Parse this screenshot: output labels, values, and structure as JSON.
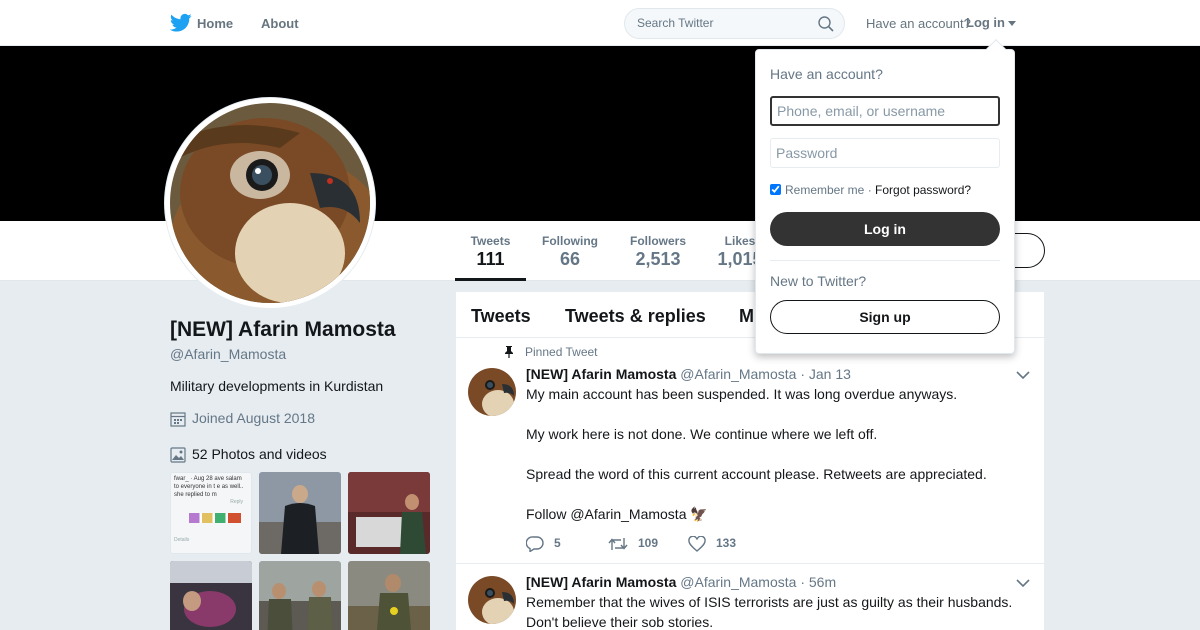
{
  "nav": {
    "home_label": "Home",
    "about_label": "About",
    "search_placeholder": "Search Twitter",
    "have_account": "Have an account?",
    "login_label": "Log in"
  },
  "profile": {
    "name": "[NEW] Afarin Mamosta",
    "handle": "@Afarin_Mamosta",
    "bio": "Military developments in Kurdistan",
    "joined": "Joined August 2018",
    "photos_label": "52 Photos and videos",
    "thumb_text": "fwar_ · Aug 28 ave salam to everyone in t e as well.. she replied to m",
    "thumb_reply": "Reply",
    "thumb_details": "Details"
  },
  "stats": [
    {
      "label": "Tweets",
      "value": "111"
    },
    {
      "label": "Following",
      "value": "66"
    },
    {
      "label": "Followers",
      "value": "2,513"
    },
    {
      "label": "Likes",
      "value": "1,015"
    }
  ],
  "tabs": [
    "Tweets",
    "Tweets & replies",
    "M"
  ],
  "tweets": [
    {
      "pinned_label": "Pinned Tweet",
      "name": "[NEW] Afarin Mamosta",
      "handle": "@Afarin_Mamosta",
      "sep": "·",
      "date": "Jan 13",
      "lines": [
        "My main account has been suspended. It was long overdue anyways.",
        "My work here is not done. We continue where we left off.",
        "Spread the word of this current account please. Retweets are appreciated.",
        "Follow @Afarin_Mamosta 🦅"
      ],
      "replies": "5",
      "retweets": "109",
      "likes": "133"
    },
    {
      "name": "[NEW] Afarin Mamosta",
      "handle": "@Afarin_Mamosta",
      "sep": "·",
      "date": "56m",
      "lines": [
        "Remember that the wives of ISIS terrorists are just as guilty as their husbands. Don't believe their sob stories."
      ]
    }
  ],
  "login_dropdown": {
    "title": "Have an account?",
    "username_placeholder": "Phone, email, or username",
    "password_placeholder": "Password",
    "remember_label": "Remember me",
    "sep": "·",
    "forgot_label": "Forgot password?",
    "login_button": "Log in",
    "new_label": "New to Twitter?",
    "signup_button": "Sign up"
  },
  "colors": {
    "accent_blue": "#1da1f2",
    "dark_button": "#333333",
    "muted_text": "#657786",
    "page_bg": "#e6ecf0"
  }
}
